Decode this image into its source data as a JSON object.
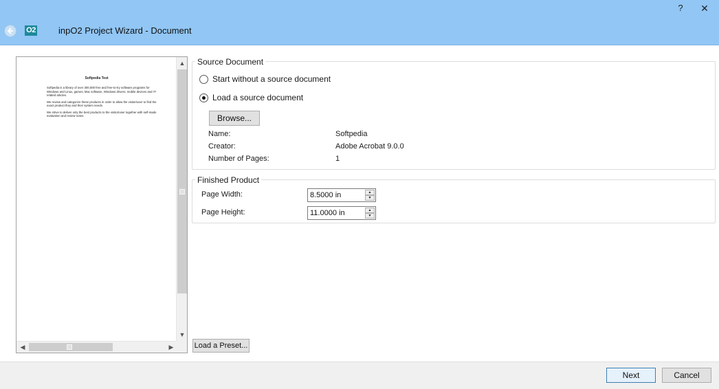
{
  "window": {
    "title": "inpO2 Project Wizard - Document",
    "logo_text": "O2",
    "help_label": "?",
    "close_label": "✕"
  },
  "preview": {
    "title": "Softpedia Test",
    "paragraphs": [
      "Softpedia is a library of over 300,000 free and free-to-try software programs for Windows and Linux, games, Mac software, Windows drivers, mobile devices and IT-related articles.",
      "We review and categorize these products in order to allow the visitor/user to find the exact product they and their system needs.",
      "We strive to deliver only the best products to the visitor/user together with self-made evaluation and review notes."
    ]
  },
  "source": {
    "legend": "Source Document",
    "option_none": "Start without a source document",
    "option_load": "Load a source document",
    "selected": "load",
    "browse_label": "Browse...",
    "info": [
      {
        "label": "Name:",
        "value": "Softpedia"
      },
      {
        "label": "Creator:",
        "value": "Adobe Acrobat 9.0.0"
      },
      {
        "label": "Number of Pages:",
        "value": "1"
      }
    ]
  },
  "finished": {
    "legend": "Finished Product",
    "page_width_label": "Page Width:",
    "page_width_value": "8.5000 in",
    "page_height_label": "Page Height:",
    "page_height_value": "11.0000 in"
  },
  "preset_label": "Load a Preset...",
  "footer": {
    "next_label": "Next",
    "cancel_label": "Cancel"
  },
  "icons": {
    "back": "back-arrow-icon",
    "spin_up": "spin-up-icon",
    "spin_down": "spin-down-icon"
  },
  "colors": {
    "titlebar": "#91c6f5",
    "logo": "#1d8a9a",
    "default_button_border": "#3c7fb1"
  }
}
